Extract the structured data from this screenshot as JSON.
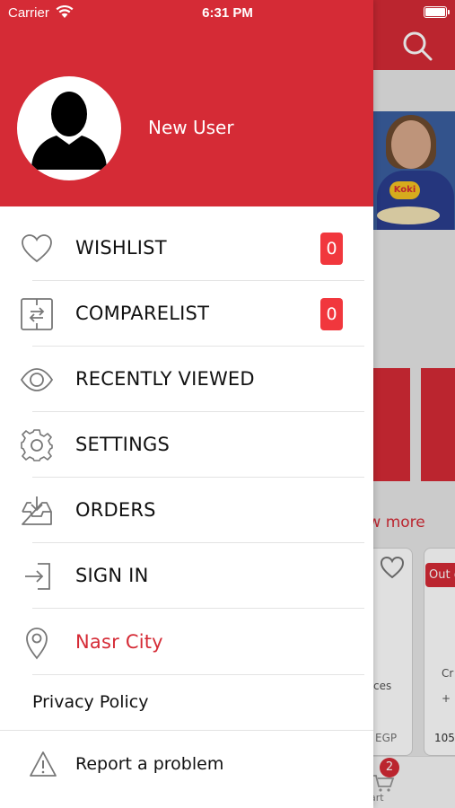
{
  "status_bar": {
    "carrier": "Carrier",
    "time": "6:31 PM"
  },
  "background": {
    "show_more": "ow more",
    "out_badge": "Out o",
    "card_texts": [
      "ces",
      "Cr",
      "+ F",
      "EGP",
      "105"
    ],
    "cart_count": "2",
    "cart_label": "art",
    "banner_logo": "Koki"
  },
  "drawer": {
    "user_name": "New User",
    "menu": [
      {
        "label": "WISHLIST",
        "icon": "heart-icon",
        "badge": "0"
      },
      {
        "label": "COMPARELIST",
        "icon": "compare-icon",
        "badge": "0"
      },
      {
        "label": "RECENTLY VIEWED",
        "icon": "eye-icon"
      },
      {
        "label": "SETTINGS",
        "icon": "gear-icon"
      },
      {
        "label": "ORDERS",
        "icon": "inbox-download-icon"
      },
      {
        "label": "SIGN IN",
        "icon": "sign-in-icon"
      },
      {
        "label": "Nasr City",
        "icon": "location-pin-icon"
      }
    ],
    "privacy_policy": "Privacy Policy",
    "report_problem": "Report a problem"
  },
  "colors": {
    "brand_red": "#d52b36",
    "badge_red": "#f1373d",
    "location_text": "#d52b36"
  }
}
